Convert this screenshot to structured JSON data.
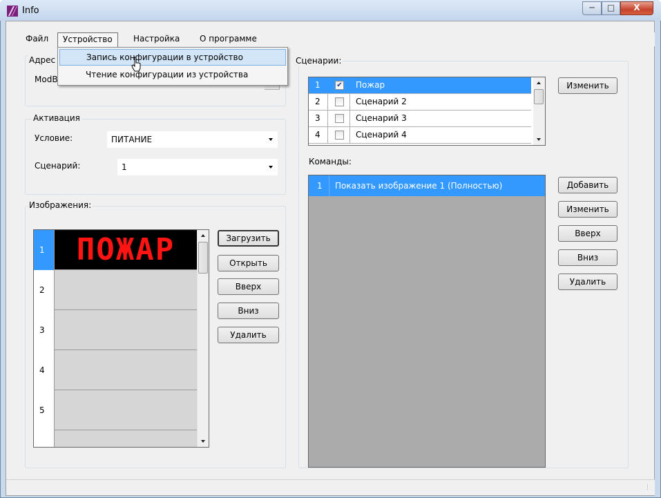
{
  "window": {
    "title": "Info",
    "minimize_label": "─",
    "maximize_label": "□",
    "close_label": "X"
  },
  "menu": {
    "file": "Файл",
    "device": "Устройство",
    "settings": "Настройка",
    "about": "О программе"
  },
  "dropdown": {
    "write": "Запись конфигурации в устройство",
    "read": "Чтение конфигурации из устройства"
  },
  "address_group": {
    "title": "Адрес",
    "modbus_label": "ModB"
  },
  "activation": {
    "title": "Активация",
    "condition_label": "Условие:",
    "condition_value": "ПИТАНИЕ",
    "scenario_label": "Сценарий:",
    "scenario_value": "1"
  },
  "images": {
    "title": "Изображения:",
    "rows": [
      {
        "no": "1",
        "content": "ПОЖАР"
      },
      {
        "no": "2",
        "content": ""
      },
      {
        "no": "3",
        "content": ""
      },
      {
        "no": "4",
        "content": ""
      },
      {
        "no": "5",
        "content": ""
      }
    ],
    "buttons": {
      "load": "Загрузить",
      "open": "Открыть",
      "up": "Вверх",
      "down": "Вниз",
      "delete": "Удалить"
    }
  },
  "scenarios": {
    "title": "Сценарии:",
    "rows": [
      {
        "no": "1",
        "checked": "✔",
        "name": "Пожар"
      },
      {
        "no": "2",
        "checked": "",
        "name": "Сценарий 2"
      },
      {
        "no": "3",
        "checked": "",
        "name": "Сценарий 3"
      },
      {
        "no": "4",
        "checked": "",
        "name": "Сценарий 4"
      }
    ],
    "edit_button": "Изменить"
  },
  "commands": {
    "title": "Команды:",
    "rows": [
      {
        "no": "1",
        "text": "Показать изображение 1 (Полностью)"
      }
    ],
    "buttons": {
      "add": "Добавить",
      "edit": "Изменить",
      "up": "Вверх",
      "down": "Вниз",
      "delete": "Удалить"
    }
  },
  "colors": {
    "selection": "#3399ff",
    "led_text": "#ff1414",
    "led_background": "#000000",
    "commands_background": "#ababab"
  }
}
